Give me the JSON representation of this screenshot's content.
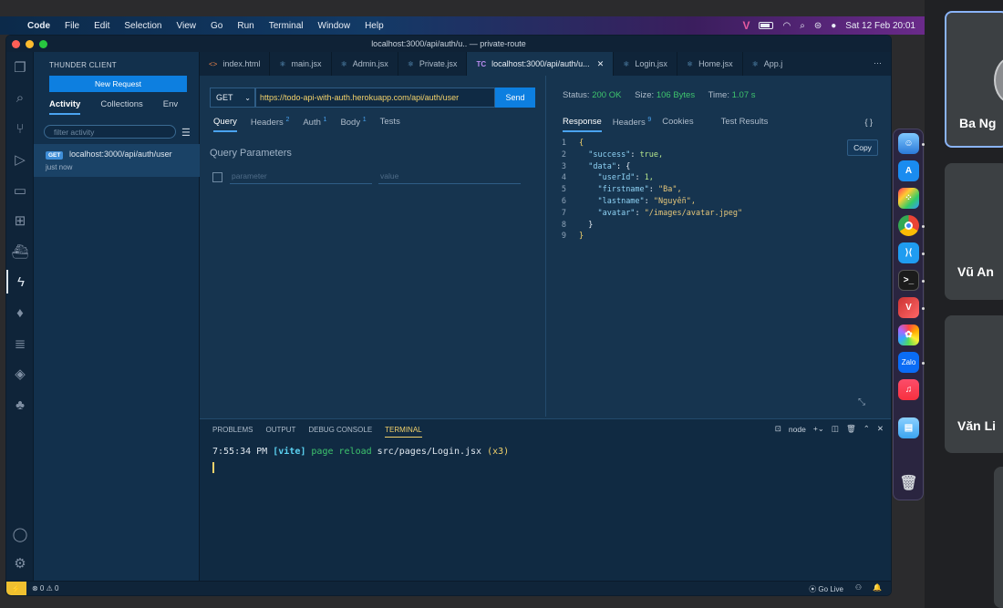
{
  "menubar": {
    "items": [
      "Code",
      "File",
      "Edit",
      "Selection",
      "View",
      "Go",
      "Run",
      "Terminal",
      "Window",
      "Help"
    ],
    "date_time": "Sat 12 Feb  20:01"
  },
  "window": {
    "title": "localhost:3000/api/auth/u.. — private-route"
  },
  "activity_bar": {
    "icons": [
      "explorer-icon",
      "search-icon",
      "source-control-icon",
      "run-debug-icon",
      "remote-explorer-icon",
      "extensions-icon",
      "docker-icon",
      "thunder-client-icon",
      "mongodb-icon",
      "database-icon",
      "layers-icon",
      "tree-icon",
      "account-icon",
      "settings-icon"
    ]
  },
  "sidebar": {
    "title": "THUNDER CLIENT",
    "new_request": "New Request",
    "tabs": [
      "Activity",
      "Collections",
      "Env"
    ],
    "filter_placeholder": "filter activity",
    "activity": [
      {
        "method": "GET",
        "url": "localhost:3000/api/auth/user",
        "time": "just now"
      }
    ]
  },
  "editor_tabs": [
    {
      "label": "index.html",
      "icon": "<>",
      "active": false
    },
    {
      "label": "main.jsx",
      "icon": "⚛",
      "active": false
    },
    {
      "label": "Admin.jsx",
      "icon": "⚛",
      "active": false
    },
    {
      "label": "Private.jsx",
      "icon": "⚛",
      "active": false
    },
    {
      "label": "localhost:3000/api/auth/u...",
      "icon": "TC",
      "active": true
    },
    {
      "label": "Login.jsx",
      "icon": "⚛",
      "active": false
    },
    {
      "label": "Home.jsx",
      "icon": "⚛",
      "active": false
    },
    {
      "label": "App.j",
      "icon": "⚛",
      "active": false
    }
  ],
  "request": {
    "method": "GET",
    "url": "https://todo-api-with-auth.herokuapp.com/api/auth/user",
    "send": "Send",
    "tabs": [
      {
        "label": "Query",
        "count": ""
      },
      {
        "label": "Headers",
        "count": "2"
      },
      {
        "label": "Auth",
        "count": "1"
      },
      {
        "label": "Body",
        "count": "1"
      },
      {
        "label": "Tests",
        "count": ""
      }
    ],
    "query_title": "Query Parameters",
    "param_placeholder": "parameter",
    "value_placeholder": "value"
  },
  "response": {
    "status_label": "Status:",
    "status": "200 OK",
    "size_label": "Size:",
    "size": "106 Bytes",
    "time_label": "Time:",
    "time": "1.07 s",
    "tabs": [
      {
        "label": "Response",
        "count": ""
      },
      {
        "label": "Headers",
        "count": "9"
      },
      {
        "label": "Cookies",
        "count": ""
      },
      {
        "label": "Test Results",
        "count": ""
      }
    ],
    "braces": "{ }",
    "copy": "Copy",
    "lines": {
      "l1": "{",
      "l2k": "\"success\"",
      "l2v": "true,",
      "l3k": "\"data\"",
      "l3v": "{",
      "l4k": "\"userId\"",
      "l4v": "1,",
      "l5k": "\"firstname\"",
      "l5v": "\"Ba\",",
      "l6k": "\"lastname\"",
      "l6v": "\"Nguyễn\",",
      "l7k": "\"avatar\"",
      "l7v": "\"/images/avatar.jpeg\"",
      "l8": "}",
      "l9": "}"
    }
  },
  "panel": {
    "tabs": [
      "PROBLEMS",
      "OUTPUT",
      "DEBUG CONSOLE",
      "TERMINAL"
    ],
    "shell": "node",
    "terminal": {
      "time": "7:55:34 PM",
      "tag": "[vite]",
      "msg": "page reload",
      "file": "src/pages/Login.jsx",
      "count": "(x3)"
    }
  },
  "statusbar": {
    "errors": "⊗ 0 ⚠ 0",
    "golive": "Go Live"
  },
  "dock": {
    "apps": [
      "finder-icon",
      "app-store-icon",
      "launchpad-icon",
      "chrome-icon",
      "vscode-icon",
      "terminal-icon",
      "vivaldi-icon",
      "photos-icon",
      "zalo-icon",
      "music-icon",
      "folder-icon",
      "trash-icon"
    ],
    "zalo_label": "Zalo"
  },
  "meet": {
    "participants": [
      "Ba Ng",
      "Vũ An",
      "Văn Li"
    ]
  },
  "colors": {
    "accent": "#0d7fe0",
    "status_ok": "#3ec46d",
    "url": "#f3d26b"
  }
}
